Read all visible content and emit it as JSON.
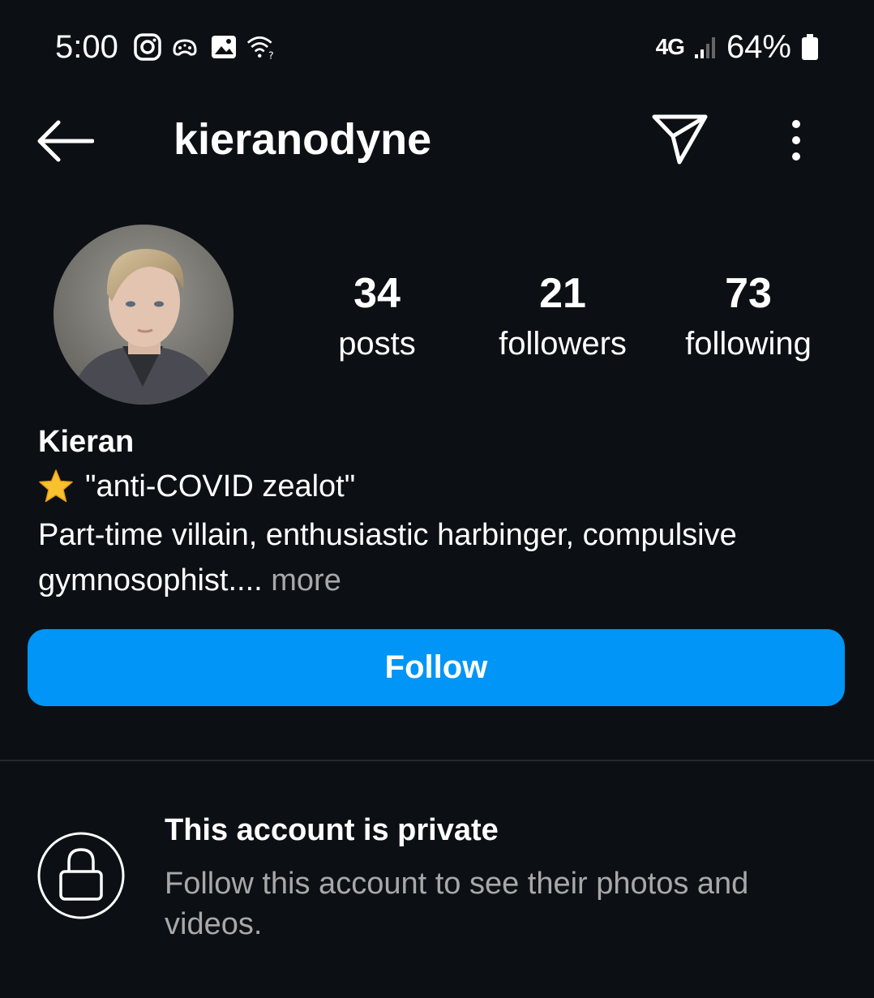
{
  "status_bar": {
    "time": "5:00",
    "left_icons": [
      "instagram-icon",
      "game-controller-icon",
      "gallery-icon",
      "wifi-question-icon"
    ],
    "network": "4G",
    "battery": "64%"
  },
  "header": {
    "username": "kieranodyne"
  },
  "stats": {
    "posts": {
      "count": "34",
      "label": "posts"
    },
    "followers": {
      "count": "21",
      "label": "followers"
    },
    "following": {
      "count": "73",
      "label": "following"
    }
  },
  "bio": {
    "name": "Kieran",
    "tagline": "\"anti-COVID zealot\"",
    "text": "Part-time villain, enthusiastic harbinger, compulsive gymnosophist.... ",
    "more": "more"
  },
  "follow_button": {
    "label": "Follow",
    "color": "#0095f6"
  },
  "private_notice": {
    "title": "This account is private",
    "description": "Follow this account to see their photos and videos."
  },
  "colors": {
    "background": "#0c1014",
    "muted_text": "#a8a8a8"
  }
}
